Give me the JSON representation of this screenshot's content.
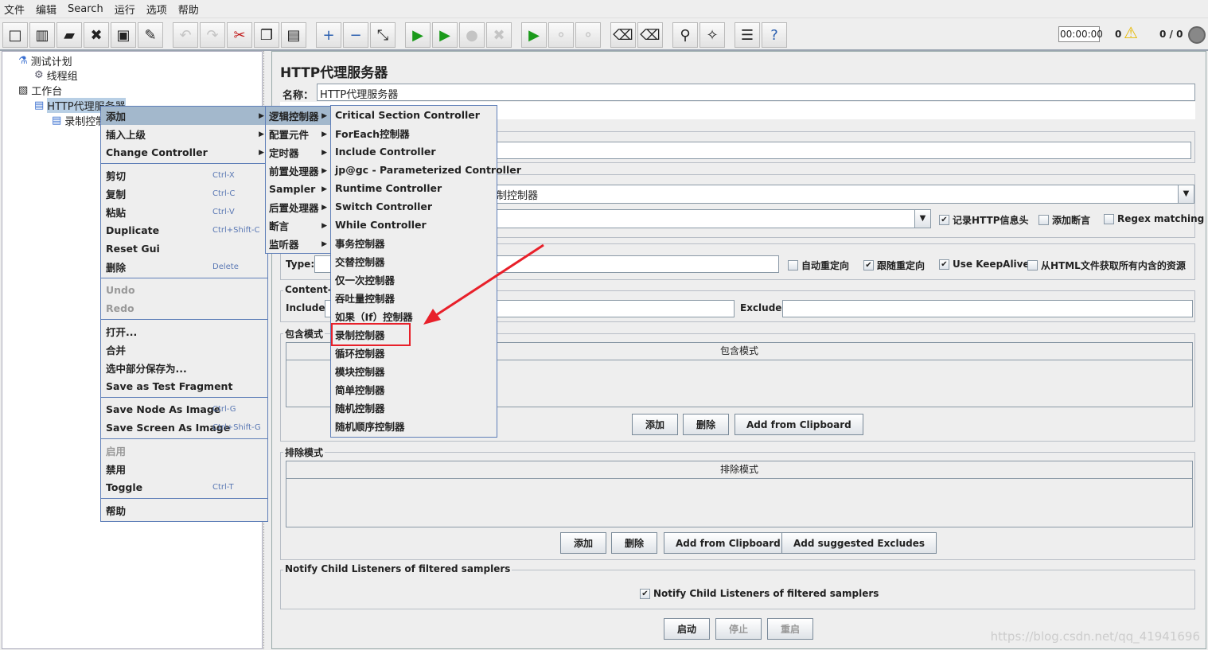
{
  "menubar": [
    "文件",
    "编辑",
    "Search",
    "运行",
    "选项",
    "帮助"
  ],
  "toolbar": {
    "icons": [
      "new-icon",
      "templates-icon",
      "open-icon",
      "close-icon",
      "save-icon",
      "save-as-icon",
      "undo-icon",
      "redo-icon",
      "cut-icon",
      "copy-icon",
      "paste-icon",
      "expand-icon",
      "collapse-icon",
      "toggle-icon",
      "start-icon",
      "start-no-pause-icon",
      "stop-icon",
      "shutdown-icon",
      "remote-start-icon",
      "remote-stop-icon",
      "remote-shutdown-icon",
      "clear-icon",
      "clear-all-icon",
      "search-icon",
      "reset-search-icon",
      "function-helper-icon",
      "help-icon"
    ],
    "timer": "00:00:00",
    "warnings": "0",
    "threads": "0 / 0"
  },
  "tree": {
    "nodes": [
      "测试计划",
      "线程组",
      "工作台",
      "HTTP代理服务器",
      "录制控制器"
    ]
  },
  "context_menu": {
    "items": [
      {
        "label": "添加",
        "shortcut": "",
        "submenu": true,
        "highlighted": true
      },
      {
        "label": "插入上级",
        "shortcut": "",
        "submenu": true
      },
      {
        "label": "Change Controller",
        "shortcut": "",
        "submenu": true
      },
      {
        "label": "剪切",
        "shortcut": "Ctrl-X",
        "sep": true
      },
      {
        "label": "复制",
        "shortcut": "Ctrl-C"
      },
      {
        "label": "粘贴",
        "shortcut": "Ctrl-V"
      },
      {
        "label": "Duplicate",
        "shortcut": "Ctrl+Shift-C"
      },
      {
        "label": "Reset Gui",
        "shortcut": ""
      },
      {
        "label": "删除",
        "shortcut": "Delete"
      },
      {
        "label": "Undo",
        "shortcut": "",
        "disabled": true,
        "sep": true
      },
      {
        "label": "Redo",
        "shortcut": "",
        "disabled": true
      },
      {
        "label": "打开...",
        "shortcut": "",
        "sep": true
      },
      {
        "label": "合并",
        "shortcut": ""
      },
      {
        "label": "选中部分保存为...",
        "shortcut": ""
      },
      {
        "label": "Save as Test Fragment",
        "shortcut": ""
      },
      {
        "label": "Save Node As Image",
        "shortcut": "Ctrl-G",
        "sep": true
      },
      {
        "label": "Save Screen As Image",
        "shortcut": "Ctrl+Shift-G"
      },
      {
        "label": "启用",
        "shortcut": "",
        "disabled": true,
        "sep": true
      },
      {
        "label": "禁用",
        "shortcut": ""
      },
      {
        "label": "Toggle",
        "shortcut": "Ctrl-T"
      },
      {
        "label": "帮助",
        "shortcut": "",
        "sep": true
      }
    ]
  },
  "add_submenu": [
    "逻辑控制器",
    "配置元件",
    "定时器",
    "前置处理器",
    "Sampler",
    "后置处理器",
    "断言",
    "监听器"
  ],
  "logic_submenu": {
    "items": [
      "Critical Section Controller",
      "ForEach控制器",
      "Include Controller",
      "jp@gc - Parameterized Controller",
      "Runtime Controller",
      "Switch Controller",
      "While Controller",
      "事务控制器",
      "交替控制器",
      "仅一次控制器",
      "吞吐量控制器",
      "如果（If）控制器",
      "录制控制器",
      "循环控制器",
      "模块控制器",
      "简单控制器",
      "随机控制器",
      "随机顺序控制器"
    ],
    "highlighted_index": 12,
    "annotation_color": "#e8202a"
  },
  "panel": {
    "title": "HTTP代理服务器",
    "name_label": "名称：",
    "name_value": "HTTP代理服务器",
    "target_partial": "制控制器",
    "checks_row1": [
      {
        "label": "记录HTTP信息头",
        "checked": true
      },
      {
        "label": "添加断言",
        "checked": false
      },
      {
        "label": "Regex matching",
        "checked": false
      }
    ],
    "type_label": "Type:",
    "checks_row2": [
      {
        "label": "自动重定向",
        "checked": false
      },
      {
        "label": "跟随重定向",
        "checked": true
      },
      {
        "label": "Use KeepAlive",
        "checked": true
      },
      {
        "label": "从HTML文件获取所有内含的资源",
        "checked": false
      }
    ],
    "content_type_legend": "Content-t",
    "include_label": "Include:",
    "exclude_label": "Exclude:",
    "include_group": {
      "legend": "包含模式",
      "header": "包含模式",
      "buttons": [
        "添加",
        "删除",
        "Add from Clipboard"
      ]
    },
    "exclude_group": {
      "legend": "排除模式",
      "header": "排除模式",
      "buttons": [
        "添加",
        "删除",
        "Add from Clipboard",
        "Add suggested Excludes"
      ]
    },
    "notify": {
      "legend": "Notify Child Listeners of filtered samplers",
      "label": "Notify Child Listeners of filtered samplers",
      "checked": true
    },
    "actions": [
      {
        "label": "启动",
        "disabled": false
      },
      {
        "label": "停止",
        "disabled": true
      },
      {
        "label": "重启",
        "disabled": true
      }
    ]
  },
  "watermark": "https://blog.csdn.net/qq_41941696"
}
